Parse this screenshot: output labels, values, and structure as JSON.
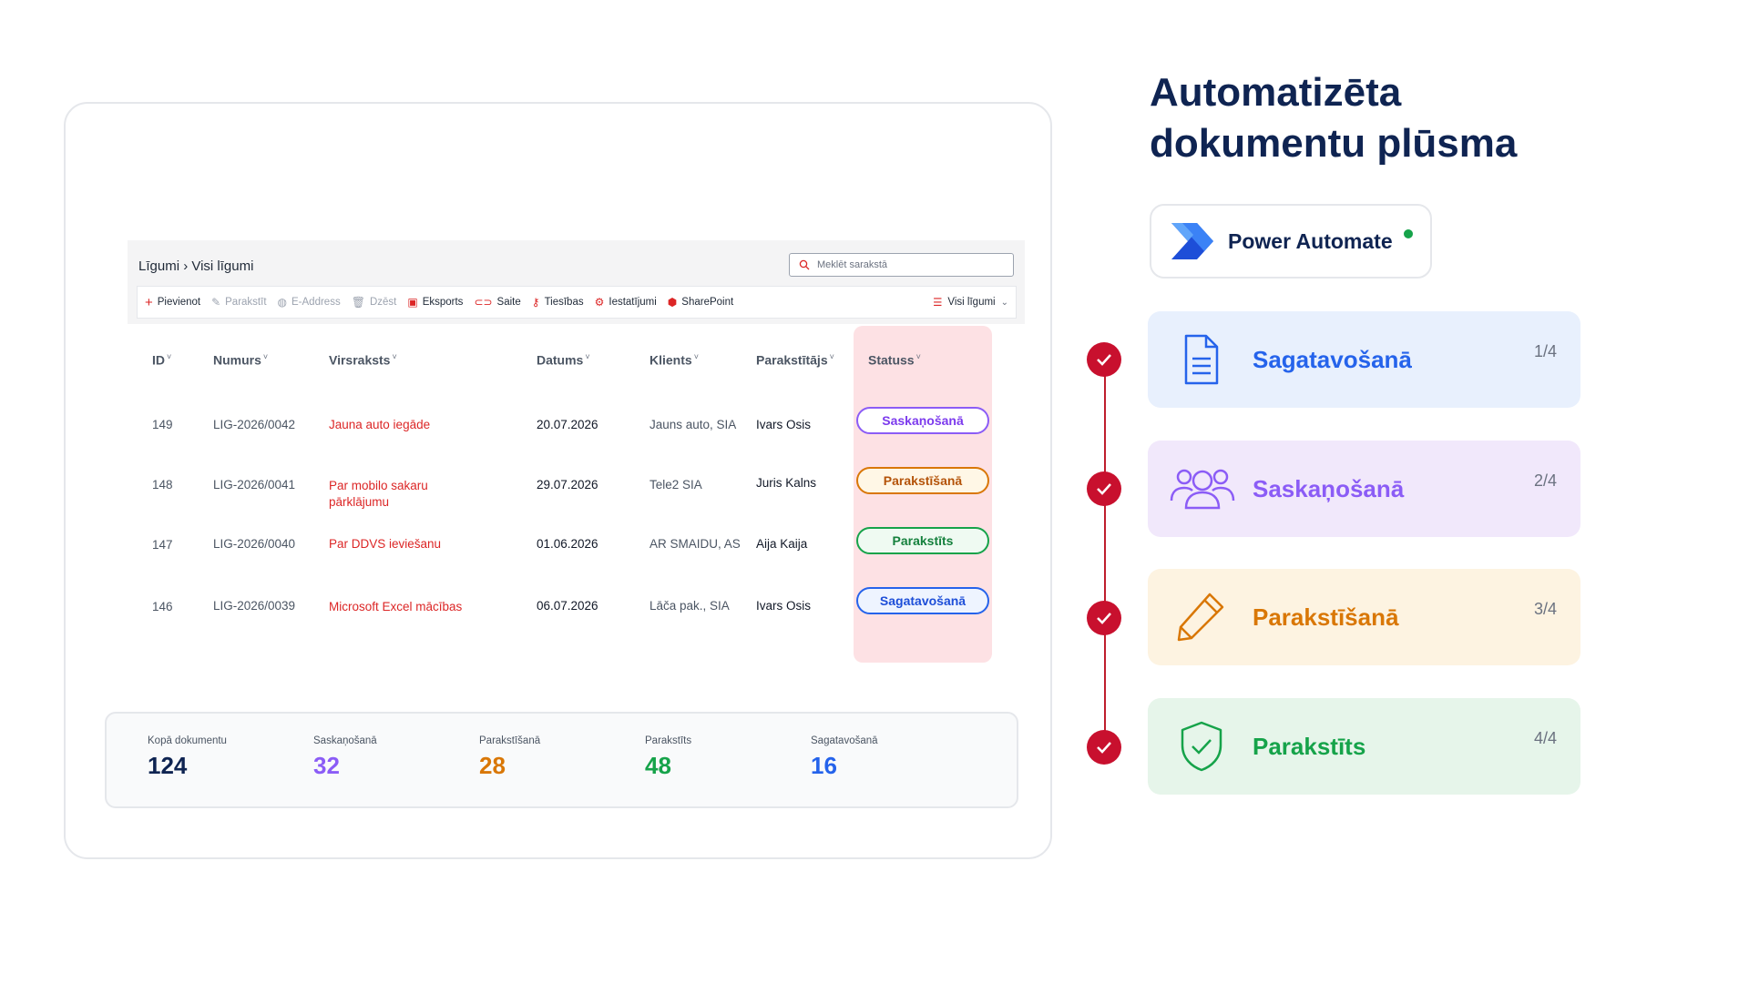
{
  "slide": {
    "title_line1": "Automatizēta",
    "title_line2": "dokumentu plūsma",
    "power_automate_label": "Power Automate"
  },
  "sharepoint": {
    "breadcrumb": "Līgumi › Visi līgumi",
    "search_placeholder": "Meklēt sarakstā",
    "toolbar": {
      "add": "Pievienot",
      "sign": "Parakstīt",
      "eaddress": "E-Address",
      "delete": "Dzēst",
      "export": "Eksports",
      "link": "Saite",
      "permissions": "Tiesības",
      "settings": "Iestatījumi",
      "sharepoint": "SharePoint",
      "view": "Visi līgumi"
    },
    "columns": [
      "ID",
      "Numurs",
      "Virsraksts",
      "Datums",
      "Klients",
      "Parakstītājs",
      "Statuss"
    ],
    "rows": [
      {
        "id": "149",
        "number": "LIG-2026/0042",
        "title": "Jauna auto iegāde",
        "date": "20.07.2026",
        "client": "Jauns auto, SIA",
        "signer": "Ivars Osis",
        "status": "Saskaņošanā"
      },
      {
        "id": "148",
        "number": "LIG-2026/0041",
        "title": "Par mobilo sakaru pārklājumu",
        "date": "29.07.2026",
        "client": "Tele2 SIA",
        "signer": "Juris Kalns",
        "status": "Parakstīšanā"
      },
      {
        "id": "147",
        "number": "LIG-2026/0040",
        "title": "Par DDVS ieviešanu",
        "date": "01.06.2026",
        "client": "AR SMAIDU, AS",
        "signer": "Aija Kaija",
        "status": "Parakstīts"
      },
      {
        "id": "146",
        "number": "LIG-2026/0039",
        "title": "Microsoft Excel mācības",
        "date": "06.07.2026",
        "client": "Lāča pak., SIA",
        "signer": "Ivars Osis",
        "status": "Sagatavošanā"
      }
    ],
    "stats": [
      {
        "label": "Kopā dokumentu",
        "value": "124",
        "color": "#0f2452"
      },
      {
        "label": "Saskaņošanā",
        "value": "32",
        "color": "#8b5cf6"
      },
      {
        "label": "Parakstīšanā",
        "value": "28",
        "color": "#d97706"
      },
      {
        "label": "Parakstīts",
        "value": "48",
        "color": "#16a34a"
      },
      {
        "label": "Sagatavošanā",
        "value": "16",
        "color": "#2563eb"
      }
    ]
  },
  "steps": [
    {
      "label": "Sagatavošanā",
      "count": "1/4",
      "icon": "document-icon",
      "color": "#2563eb",
      "bg": "#e8f0fd"
    },
    {
      "label": "Saskaņošanā",
      "count": "2/4",
      "icon": "people-icon",
      "color": "#8b5cf6",
      "bg": "#f1e8fb"
    },
    {
      "label": "Parakstīšanā",
      "count": "3/4",
      "icon": "pen-icon",
      "color": "#d97706",
      "bg": "#fdf3e1"
    },
    {
      "label": "Parakstīts",
      "count": "4/4",
      "icon": "shield-check-icon",
      "color": "#16a34a",
      "bg": "#e6f5ea"
    }
  ],
  "status_colors": {
    "Saskaņošanā": {
      "border": "#8b5cf6",
      "text": "#7c3aed"
    },
    "Parakstīšanā": {
      "border": "#d97706",
      "text": "#b45309"
    },
    "Parakstīts": {
      "border": "#16a34a",
      "text": "#15803d"
    },
    "Sagatavošanā": {
      "border": "#2563eb",
      "text": "#1d4ed8"
    }
  }
}
